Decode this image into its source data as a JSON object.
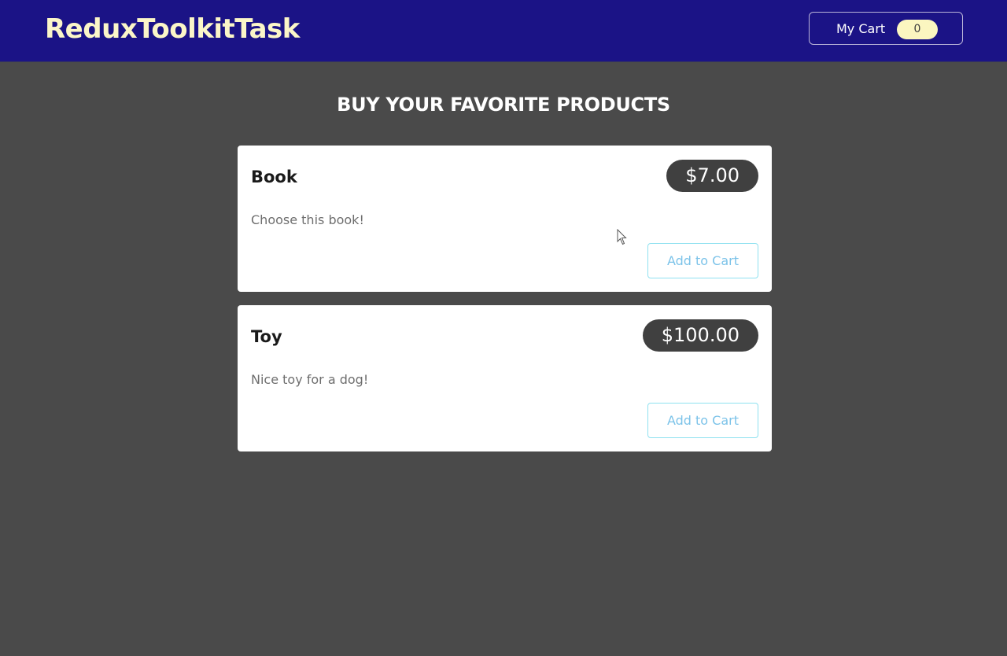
{
  "header": {
    "logo": "ReduxToolkitTask",
    "cart_label": "My Cart",
    "cart_count": "0"
  },
  "main": {
    "title": "BUY YOUR FAVORITE PRODUCTS",
    "products": [
      {
        "name": "Book",
        "price": "$7.00",
        "description": "Choose this book!",
        "button_label": "Add to Cart"
      },
      {
        "name": "Toy",
        "price": "$100.00",
        "description": "Nice toy for a dog!",
        "button_label": "Add to Cart"
      }
    ]
  },
  "colors": {
    "header_bg": "#1b1386",
    "page_bg": "#4a4a4a",
    "logo_text": "#fbf6c8",
    "badge_bg": "#fbf6c0",
    "price_bg": "#404040",
    "button_border": "#8fe1f0",
    "button_text": "#7cc3e9"
  },
  "icons": {
    "cursor": "mouse-pointer-icon"
  }
}
